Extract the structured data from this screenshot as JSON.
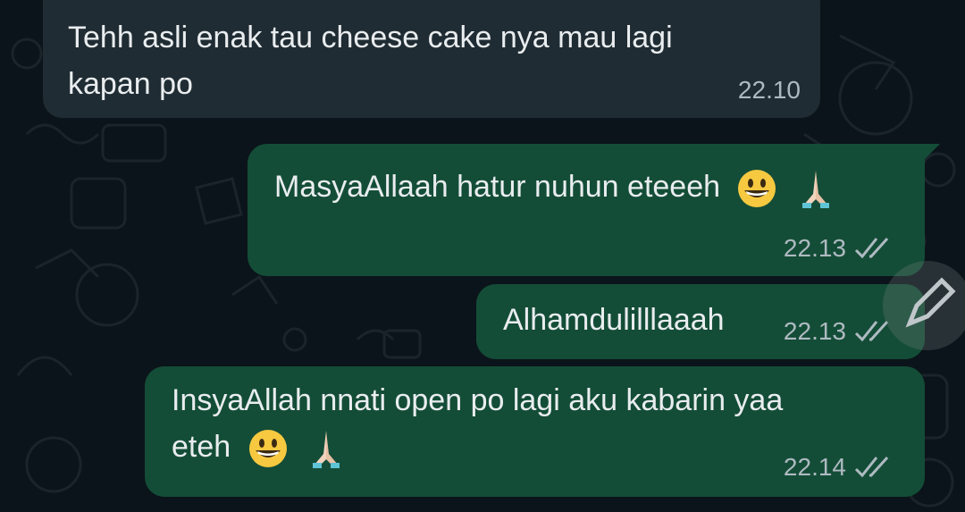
{
  "chat": {
    "messages": [
      {
        "direction": "incoming",
        "text_line1": "Tehh asli enak tau cheese cake nya mau lagi",
        "text_line2": "kapan po",
        "time": "22.10"
      },
      {
        "direction": "outgoing",
        "text": "MasyaAllaah hatur nuhun eteeeh",
        "emojis": [
          "grinning-face-emoji",
          "folded-hands-emoji"
        ],
        "time": "22.13",
        "status": "read"
      },
      {
        "direction": "outgoing",
        "text": "Alhamdulilllaaah",
        "time": "22.13",
        "status": "read"
      },
      {
        "direction": "outgoing",
        "text_line1": "InsyaAllah nnati open po lagi aku kabarin yaa",
        "text_line2": "eteh",
        "emojis": [
          "grinning-face-emoji",
          "folded-hands-emoji"
        ],
        "time": "22.14",
        "status": "read"
      }
    ]
  },
  "colors": {
    "background": "#0b141a",
    "incoming_bubble": "#202c33",
    "outgoing_bubble": "#144d37",
    "text": "#e9edef",
    "meta_text": "#aebac1",
    "read_ticks": "#aebac1"
  },
  "icons": [
    "double-check-icon",
    "pencil-icon"
  ]
}
